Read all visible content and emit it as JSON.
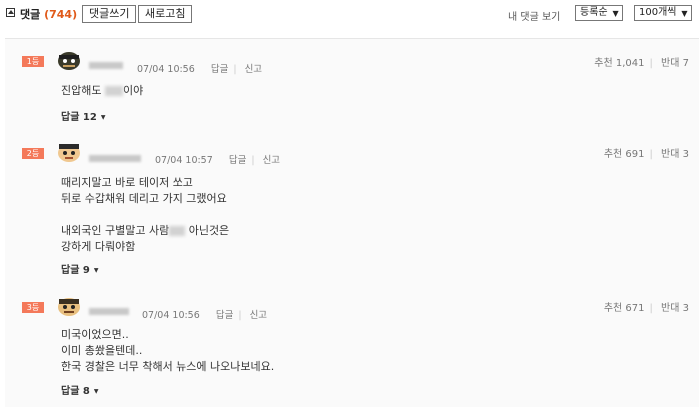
{
  "header": {
    "title": "댓글",
    "count": "(744)",
    "write_label": "댓글쓰기",
    "refresh_label": "새로고침",
    "my_comments_label": "내 댓글 보기",
    "sort_value": "등록순",
    "per_page_value": "100개씩"
  },
  "comments": [
    {
      "rank": "1등",
      "time": "07/04 10:56",
      "reply_action": "답글",
      "report_action": "신고",
      "votes": {
        "up": "추천 1,041",
        "down": "반대 7"
      },
      "lines": [
        "진압해도 ",
        "이야"
      ],
      "reply_count": "답글 12"
    },
    {
      "rank": "2등",
      "time": "07/04 10:57",
      "reply_action": "답글",
      "report_action": "신고",
      "votes": {
        "up": "추천 691",
        "down": "반대 3"
      },
      "lines": [
        "때리지말고 바로 테이저 쏘고",
        "뒤로 수갑채워 데리고 가지 그랬어요",
        "",
        "내외국인 구별말고 사람",
        " 아닌것은",
        "강하게 다뤄야함"
      ],
      "reply_count": "답글 9"
    },
    {
      "rank": "3등",
      "time": "07/04 10:56",
      "reply_action": "답글",
      "report_action": "신고",
      "votes": {
        "up": "추천 671",
        "down": "반대 3"
      },
      "lines": [
        "미국이었으면..",
        "이미 총쐈을텐데..",
        "한국 경찰은 너무 착해서 뉴스에 나오나보네요."
      ],
      "reply_count": "답글 8"
    }
  ]
}
